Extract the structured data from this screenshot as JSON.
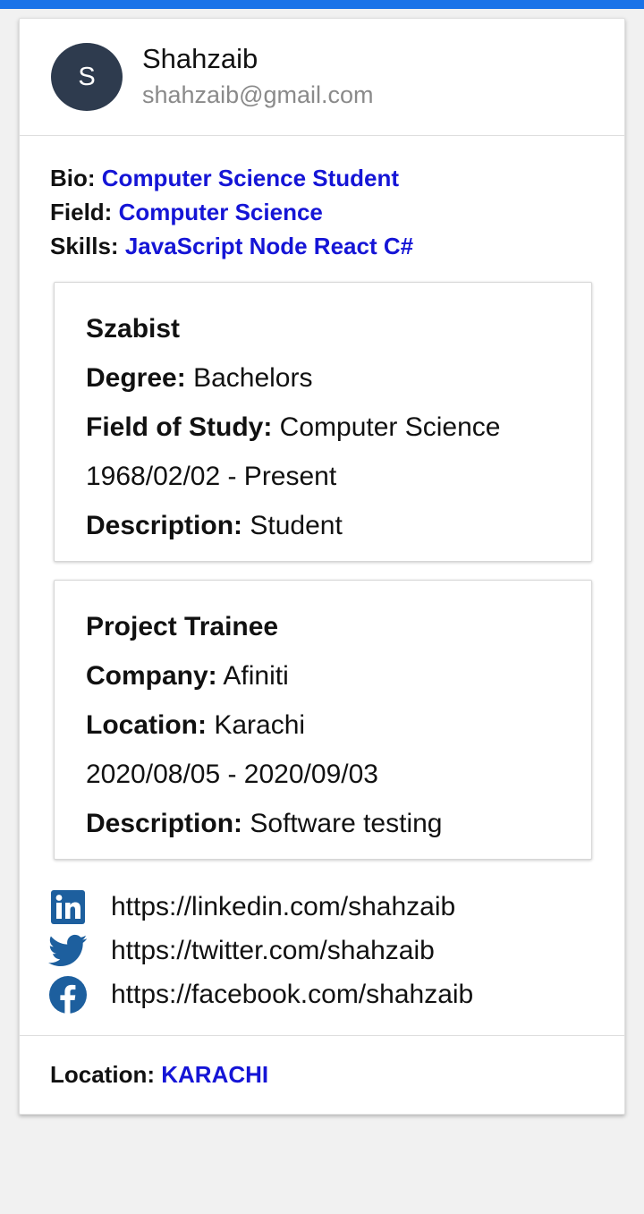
{
  "profile": {
    "avatar_initial": "S",
    "name": "Shahzaib",
    "email": "shahzaib@gmail.com"
  },
  "info": {
    "bio_label": "Bio:",
    "bio": "Computer Science Student",
    "field_label": "Field:",
    "field": "Computer Science",
    "skills_label": "Skills:",
    "skills": "JavaScript Node React C#"
  },
  "education": {
    "institution": "Szabist",
    "degree_label": "Degree:",
    "degree": "Bachelors",
    "field_label": "Field of Study:",
    "field": "Computer Science",
    "dates": "1968/02/02 - Present",
    "description_label": "Description:",
    "description": "Student"
  },
  "experience": {
    "title": "Project Trainee",
    "company_label": "Company:",
    "company": "Afiniti",
    "location_label": "Location:",
    "location": "Karachi",
    "dates": "2020/08/05 - 2020/09/03",
    "description_label": "Description:",
    "description": "Software testing"
  },
  "social": [
    {
      "icon": "linkedin-icon",
      "url": "https://linkedin.com/shahzaib"
    },
    {
      "icon": "twitter-icon",
      "url": "https://twitter.com/shahzaib"
    },
    {
      "icon": "facebook-icon",
      "url": "https://facebook.com/shahzaib"
    }
  ],
  "footer": {
    "location_label": "Location:",
    "location": "KARACHI"
  },
  "colors": {
    "accent_bar": "#1a73e8",
    "link_text": "#1515d6",
    "avatar_bg": "#2e3b4e",
    "social_icon": "#1d5f9e"
  }
}
